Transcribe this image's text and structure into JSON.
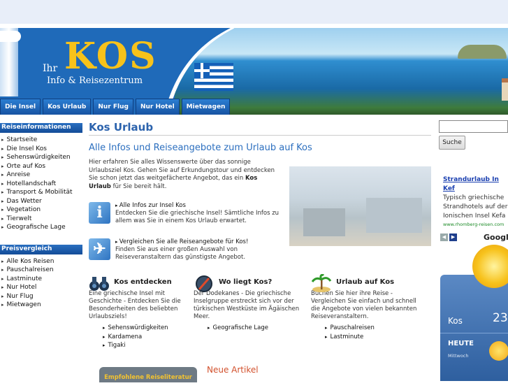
{
  "header": {
    "logo_ihr": "Ihr",
    "logo_kos": "KOS",
    "logo_sub": "Info & Reisezentrum"
  },
  "nav": [
    "Die Insel",
    "Kos Urlaub",
    "Nur Flug",
    "Nur Hotel",
    "Mietwagen"
  ],
  "sidebar": {
    "section1_title": "Reiseinformationen",
    "section1_items": [
      "Startseite",
      "Die Insel Kos",
      "Sehenswürdigkeiten",
      "Orte auf Kos",
      "Anreise",
      "Hotellandschaft",
      "Transport & Mobilität",
      "Das Wetter",
      "Vegetation",
      "Tierwelt",
      "Geografische Lage"
    ],
    "section2_title": "Preisvergleich",
    "section2_items": [
      "Alle Kos Reisen",
      "Pauschalreisen",
      "Lastminute",
      "Nur Hotel",
      "Nur Flug",
      "Mietwagen"
    ]
  },
  "main": {
    "title": "Kos Urlaub",
    "subtitle": "Alle Infos und Reiseangebote zum Urlaub auf Kos",
    "intro_before": "Hier erfahren Sie alles Wissenswerte über das sonnige Urlaubsziel Kos. Gehen Sie auf Erkundungstour und entdecken Sie schon jetzt das weitgefächerte Angebot, das ein ",
    "intro_bold": "Kos Urlaub",
    "intro_after": " für Sie bereit hält.",
    "feature1_link": "Alle Infos zur Insel Kos",
    "feature1_text": "Entdecken Sie die griechische Insel! Sämtliche Infos zu allem was Sie in einem Kos Urlaub erwartet.",
    "feature2_link": "Vergleichen Sie alle Reiseangebote für Kos!",
    "feature2_text": "Finden Sie aus einer großen Auswahl von Reiseveranstaltern das günstigste Angebot.",
    "col1_title": "Kos entdecken",
    "col1_text": "Eine griechische Insel mit Geschichte - Entdecken Sie die Besonderheiten des beliebten Urlaubsziels!",
    "col1_links": [
      "Sehenswürdigkeiten",
      "Kardamena",
      "Tigaki"
    ],
    "col2_title": "Wo liegt Kos?",
    "col2_text": "Der Dodekanes - Die griechische Inselgruppe erstreckt sich vor der türkischen Westküste im Ägäischen Meer.",
    "col2_links": [
      "Geografische Lage"
    ],
    "col3_title": "Urlaub auf Kos",
    "col3_text": "Buchen Sie hier ihre Reise - Vergleichen Sie einfach und schnell die Angebote von vielen bekannten Reiseveranstaltern.",
    "col3_links": [
      "Pauschalreisen",
      "Lastminute"
    ],
    "reco_label": "Empfohlene Reiseliteratur",
    "neue_label": "Neue Artikel"
  },
  "right": {
    "search_value": "",
    "search_button": "Suche",
    "ad_title": "Strandurlaub In Kef",
    "ad_line1": "Typisch griechische",
    "ad_line2": "Strandhotels auf der",
    "ad_line3": "Ionischen Insel Kefa",
    "ad_url": "www.rhomberg-reisen.com",
    "google_label": "Google",
    "weather_city": "Kos",
    "weather_temp": "23",
    "weather_day": "HEUTE",
    "weather_dayname": "Mittwoch"
  },
  "colors": {
    "brand_blue": "#2c63ad",
    "nav_blue": "#1753a2",
    "logo_gold": "#f7c21a",
    "accent_orange": "#d2502c"
  }
}
